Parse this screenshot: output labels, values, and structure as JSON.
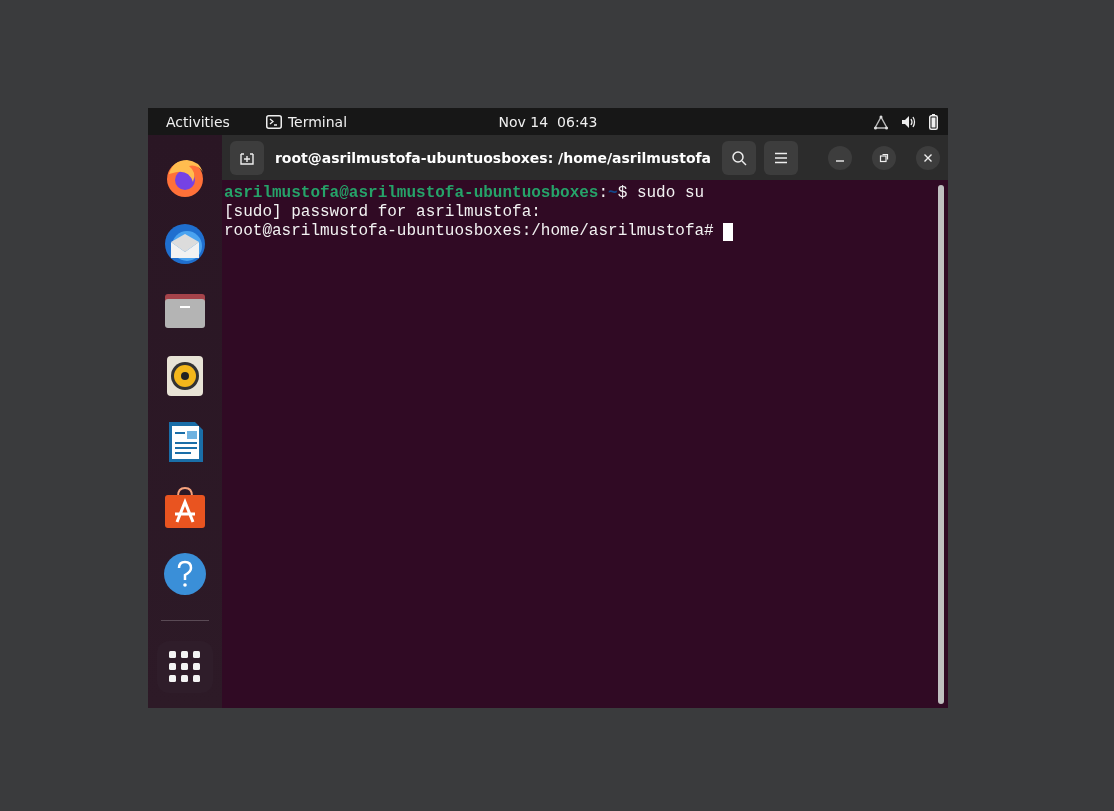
{
  "top_bar": {
    "activities": "Activities",
    "app_name": "Terminal",
    "clock": "Nov 14  06:43"
  },
  "dock": {
    "apps": [
      {
        "kind": "browser"
      },
      {
        "kind": "mail"
      },
      {
        "kind": "files"
      },
      {
        "kind": "music"
      },
      {
        "kind": "writer"
      },
      {
        "kind": "store"
      },
      {
        "kind": "help"
      }
    ]
  },
  "terminal": {
    "title": "root@asrilmustofa-ubuntuosboxes: /home/asrilmustofa",
    "lines": [
      {
        "segments": [
          {
            "kind": "user",
            "text": "asrilmustofa@asrilmustofa-ubuntuosboxes"
          },
          {
            "kind": "plain",
            "text": ":"
          },
          {
            "kind": "path",
            "text": "~"
          },
          {
            "kind": "plain",
            "text": "$ sudo su"
          }
        ]
      },
      {
        "segments": [
          {
            "kind": "plain",
            "text": "[sudo] password for asrilmustofa:"
          }
        ]
      },
      {
        "segments": [
          {
            "kind": "plain",
            "text": "root@asrilmustofa-ubuntuosboxes:/home/asrilmustofa# "
          }
        ],
        "cursor": true
      }
    ]
  }
}
